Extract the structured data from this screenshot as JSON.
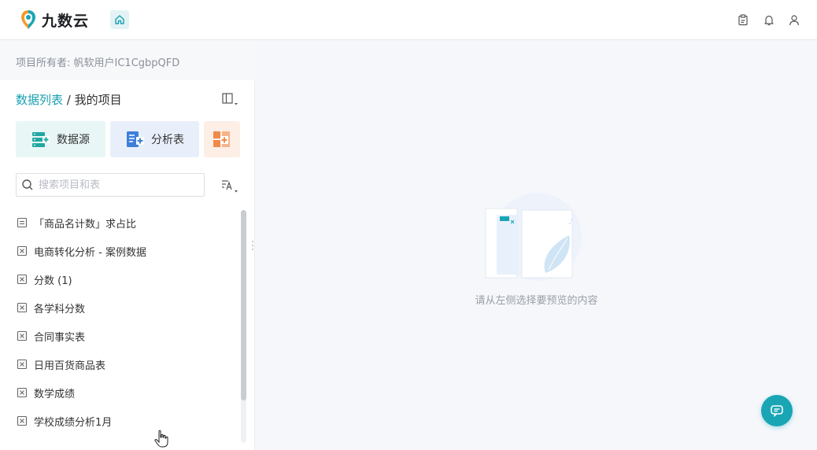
{
  "app": {
    "logo_text": "九数云"
  },
  "colors": {
    "accent": "#1a9fb0",
    "datasource_bg": "#e9f6f6",
    "analysis_bg": "#e9effa",
    "more_bg": "#fdeee6"
  },
  "header": {
    "icons": [
      "home-icon",
      "clipboard-icon",
      "bell-icon",
      "user-icon"
    ]
  },
  "sidebar": {
    "owner_text": "项目所有者: 帆软用户IC1CgbpQFD",
    "breadcrumb": {
      "root": "数据列表",
      "separator": " / ",
      "current": "我的项目"
    },
    "actions": {
      "datasource_label": "数据源",
      "analysis_label": "分析表"
    },
    "search": {
      "placeholder": "搜索项目和表",
      "value": ""
    },
    "items": [
      {
        "label": "「商品名计数」求占比",
        "icon": "sheet-icon"
      },
      {
        "label": "电商转化分析 - 案例数据",
        "icon": "excel-icon"
      },
      {
        "label": "分数 (1)",
        "icon": "excel-icon"
      },
      {
        "label": "各学科分数",
        "icon": "excel-icon"
      },
      {
        "label": "合同事实表",
        "icon": "excel-icon"
      },
      {
        "label": "日用百货商品表",
        "icon": "excel-icon"
      },
      {
        "label": "数学成绩",
        "icon": "excel-icon"
      },
      {
        "label": "学校成绩分析1月",
        "icon": "excel-icon"
      }
    ]
  },
  "main": {
    "empty_text": "请从左侧选择要预览的内容"
  }
}
